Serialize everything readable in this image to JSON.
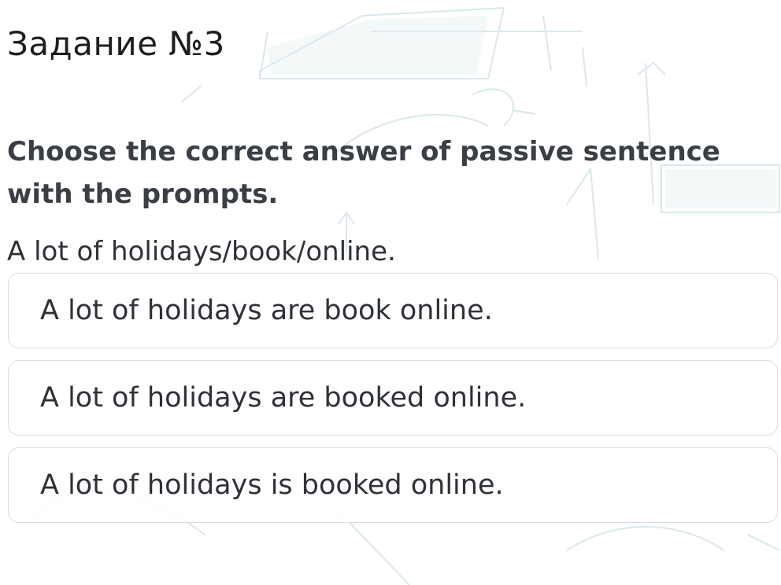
{
  "task": {
    "title": "Задание №3"
  },
  "question": {
    "text": "Choose the correct answer of passive sentence with the prompts."
  },
  "prompt": {
    "text": "A lot of holidays/book/online."
  },
  "options": [
    {
      "label": "A lot of holidays are book online."
    },
    {
      "label": "A lot of holidays are booked online."
    },
    {
      "label": "A lot of holidays is booked online."
    }
  ],
  "colors": {
    "background": "#ffffff",
    "option_border": "#d8dde3",
    "question_text": "#3a3f46",
    "doodle": "#d6e6ea"
  }
}
